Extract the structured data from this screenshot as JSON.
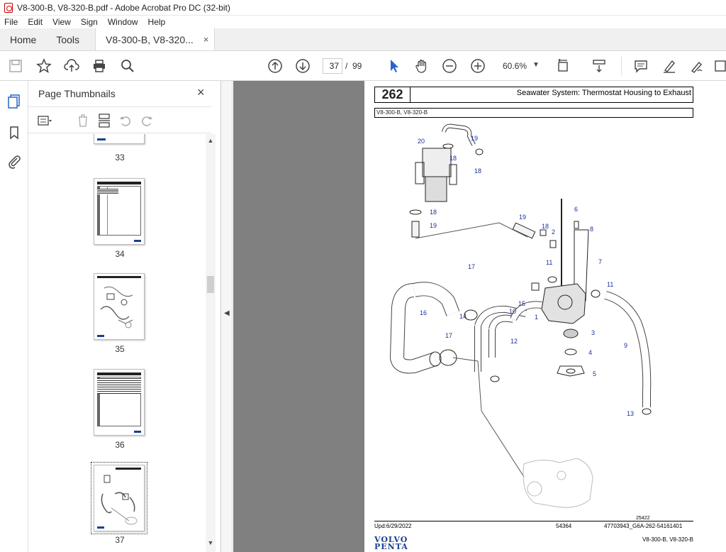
{
  "window": {
    "title": "V8-300-B, V8-320-B.pdf - Adobe Acrobat Pro DC (32-bit)"
  },
  "menu": [
    "File",
    "Edit",
    "View",
    "Sign",
    "Window",
    "Help"
  ],
  "tabs": {
    "home": "Home",
    "tools": "Tools",
    "document": "V8-300-B, V8-320...",
    "close": "×"
  },
  "toolbar": {
    "page_current": "37",
    "page_sep": "/",
    "page_total": "99",
    "zoom": "60.6%"
  },
  "panel": {
    "title": "Page Thumbnails",
    "close": "×",
    "thumbnails": [
      {
        "number": "33"
      },
      {
        "number": "34"
      },
      {
        "number": "35"
      },
      {
        "number": "36"
      },
      {
        "number": "37"
      }
    ]
  },
  "document": {
    "page_number": "262",
    "page_title": "Seawater System: Thermostat Housing to Exhaust",
    "models": "V8-300-B, V8-320-B",
    "updated": "Upd:6/29/2022",
    "footer_mid": "54364",
    "footer_code": "47703943_G6A-262-54161401",
    "figure_id": "25422",
    "brand_line1": "VOLVO",
    "brand_line2": "PENTA",
    "footer_models": "V8-300-B, V8-320-B",
    "callouts": [
      "20",
      "19",
      "18",
      "18",
      "18",
      "19",
      "19",
      "18",
      "2",
      "6",
      "8",
      "7",
      "11",
      "11",
      "17",
      "15",
      "10",
      "14",
      "16",
      "1",
      "3",
      "4",
      "5",
      "12",
      "9",
      "13",
      "17"
    ]
  }
}
